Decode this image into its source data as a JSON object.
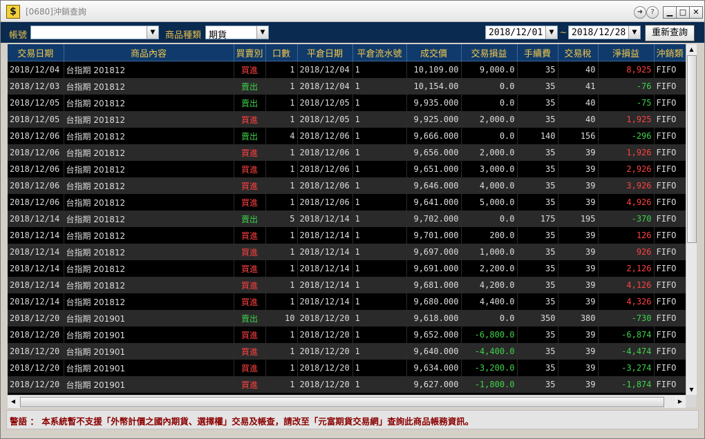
{
  "window": {
    "title": "[0680]沖銷查詢",
    "app_icon": "$"
  },
  "titlebar_buttons": {
    "help": "?",
    "minimize": "▁",
    "maximize": "□",
    "close": "✕"
  },
  "toolbar": {
    "account_label": "帳號",
    "account_value": "",
    "product_type_label": "商品種類",
    "product_type_value": "期貨",
    "date_from": "2018/12/01",
    "date_sep": "~",
    "date_to": "2018/12/28",
    "requery_label": "重新查詢"
  },
  "columns": [
    "交易日期",
    "商品內容",
    "買賣別",
    "口數",
    "平倉日期",
    "平倉流水號",
    "成交價",
    "交易損益",
    "手續費",
    "交易稅",
    "淨損益",
    "沖銷類"
  ],
  "rows": [
    {
      "date": "2018/12/04",
      "product": "台指期  201812",
      "side": "買進",
      "side_type": "buy",
      "qty": "1",
      "close_date": "2018/12/04",
      "seq": "1",
      "price": "10,109.00",
      "pl": "9,000.0",
      "pl_type": "",
      "fee": "35",
      "tax": "40",
      "net": "8,925",
      "net_type": "pos",
      "method": "FIFO"
    },
    {
      "date": "2018/12/03",
      "product": "台指期  201812",
      "side": "賣出",
      "side_type": "sell",
      "qty": "1",
      "close_date": "2018/12/04",
      "seq": "1",
      "price": "10,154.00",
      "pl": "0.0",
      "pl_type": "",
      "fee": "35",
      "tax": "41",
      "net": "-76",
      "net_type": "neg",
      "method": "FIFO"
    },
    {
      "date": "2018/12/05",
      "product": "台指期  201812",
      "side": "賣出",
      "side_type": "sell",
      "qty": "1",
      "close_date": "2018/12/05",
      "seq": "1",
      "price": "9,935.000",
      "pl": "0.0",
      "pl_type": "",
      "fee": "35",
      "tax": "40",
      "net": "-75",
      "net_type": "neg",
      "method": "FIFO"
    },
    {
      "date": "2018/12/05",
      "product": "台指期  201812",
      "side": "買進",
      "side_type": "buy",
      "qty": "1",
      "close_date": "2018/12/05",
      "seq": "1",
      "price": "9,925.000",
      "pl": "2,000.0",
      "pl_type": "",
      "fee": "35",
      "tax": "40",
      "net": "1,925",
      "net_type": "pos",
      "method": "FIFO"
    },
    {
      "date": "2018/12/06",
      "product": "台指期  201812",
      "side": "賣出",
      "side_type": "sell",
      "qty": "4",
      "close_date": "2018/12/06",
      "seq": "1",
      "price": "9,666.000",
      "pl": "0.0",
      "pl_type": "",
      "fee": "140",
      "tax": "156",
      "net": "-296",
      "net_type": "neg",
      "method": "FIFO"
    },
    {
      "date": "2018/12/06",
      "product": "台指期  201812",
      "side": "買進",
      "side_type": "buy",
      "qty": "1",
      "close_date": "2018/12/06",
      "seq": "1",
      "price": "9,656.000",
      "pl": "2,000.0",
      "pl_type": "",
      "fee": "35",
      "tax": "39",
      "net": "1,926",
      "net_type": "pos",
      "method": "FIFO"
    },
    {
      "date": "2018/12/06",
      "product": "台指期  201812",
      "side": "買進",
      "side_type": "buy",
      "qty": "1",
      "close_date": "2018/12/06",
      "seq": "1",
      "price": "9,651.000",
      "pl": "3,000.0",
      "pl_type": "",
      "fee": "35",
      "tax": "39",
      "net": "2,926",
      "net_type": "pos",
      "method": "FIFO"
    },
    {
      "date": "2018/12/06",
      "product": "台指期  201812",
      "side": "買進",
      "side_type": "buy",
      "qty": "1",
      "close_date": "2018/12/06",
      "seq": "1",
      "price": "9,646.000",
      "pl": "4,000.0",
      "pl_type": "",
      "fee": "35",
      "tax": "39",
      "net": "3,926",
      "net_type": "pos",
      "method": "FIFO"
    },
    {
      "date": "2018/12/06",
      "product": "台指期  201812",
      "side": "買進",
      "side_type": "buy",
      "qty": "1",
      "close_date": "2018/12/06",
      "seq": "1",
      "price": "9,641.000",
      "pl": "5,000.0",
      "pl_type": "",
      "fee": "35",
      "tax": "39",
      "net": "4,926",
      "net_type": "pos",
      "method": "FIFO"
    },
    {
      "date": "2018/12/14",
      "product": "台指期  201812",
      "side": "賣出",
      "side_type": "sell",
      "qty": "5",
      "close_date": "2018/12/14",
      "seq": "1",
      "price": "9,702.000",
      "pl": "0.0",
      "pl_type": "",
      "fee": "175",
      "tax": "195",
      "net": "-370",
      "net_type": "neg",
      "method": "FIFO"
    },
    {
      "date": "2018/12/14",
      "product": "台指期  201812",
      "side": "買進",
      "side_type": "buy",
      "qty": "1",
      "close_date": "2018/12/14",
      "seq": "1",
      "price": "9,701.000",
      "pl": "200.0",
      "pl_type": "",
      "fee": "35",
      "tax": "39",
      "net": "126",
      "net_type": "pos",
      "method": "FIFO"
    },
    {
      "date": "2018/12/14",
      "product": "台指期  201812",
      "side": "買進",
      "side_type": "buy",
      "qty": "1",
      "close_date": "2018/12/14",
      "seq": "1",
      "price": "9,697.000",
      "pl": "1,000.0",
      "pl_type": "",
      "fee": "35",
      "tax": "39",
      "net": "926",
      "net_type": "pos",
      "method": "FIFO"
    },
    {
      "date": "2018/12/14",
      "product": "台指期  201812",
      "side": "買進",
      "side_type": "buy",
      "qty": "1",
      "close_date": "2018/12/14",
      "seq": "1",
      "price": "9,691.000",
      "pl": "2,200.0",
      "pl_type": "",
      "fee": "35",
      "tax": "39",
      "net": "2,126",
      "net_type": "pos",
      "method": "FIFO"
    },
    {
      "date": "2018/12/14",
      "product": "台指期  201812",
      "side": "買進",
      "side_type": "buy",
      "qty": "1",
      "close_date": "2018/12/14",
      "seq": "1",
      "price": "9,681.000",
      "pl": "4,200.0",
      "pl_type": "",
      "fee": "35",
      "tax": "39",
      "net": "4,126",
      "net_type": "pos",
      "method": "FIFO"
    },
    {
      "date": "2018/12/14",
      "product": "台指期  201812",
      "side": "買進",
      "side_type": "buy",
      "qty": "1",
      "close_date": "2018/12/14",
      "seq": "1",
      "price": "9,680.000",
      "pl": "4,400.0",
      "pl_type": "",
      "fee": "35",
      "tax": "39",
      "net": "4,326",
      "net_type": "pos",
      "method": "FIFO"
    },
    {
      "date": "2018/12/20",
      "product": "台指期  201901",
      "side": "賣出",
      "side_type": "sell",
      "qty": "10",
      "close_date": "2018/12/20",
      "seq": "1",
      "price": "9,618.000",
      "pl": "0.0",
      "pl_type": "",
      "fee": "350",
      "tax": "380",
      "net": "-730",
      "net_type": "neg",
      "method": "FIFO"
    },
    {
      "date": "2018/12/20",
      "product": "台指期  201901",
      "side": "買進",
      "side_type": "buy",
      "qty": "1",
      "close_date": "2018/12/20",
      "seq": "1",
      "price": "9,652.000",
      "pl": "-6,800.0",
      "pl_type": "neg",
      "fee": "35",
      "tax": "39",
      "net": "-6,874",
      "net_type": "neg",
      "method": "FIFO"
    },
    {
      "date": "2018/12/20",
      "product": "台指期  201901",
      "side": "買進",
      "side_type": "buy",
      "qty": "1",
      "close_date": "2018/12/20",
      "seq": "1",
      "price": "9,640.000",
      "pl": "-4,400.0",
      "pl_type": "neg",
      "fee": "35",
      "tax": "39",
      "net": "-4,474",
      "net_type": "neg",
      "method": "FIFO"
    },
    {
      "date": "2018/12/20",
      "product": "台指期  201901",
      "side": "買進",
      "side_type": "buy",
      "qty": "1",
      "close_date": "2018/12/20",
      "seq": "1",
      "price": "9,634.000",
      "pl": "-3,200.0",
      "pl_type": "neg",
      "fee": "35",
      "tax": "39",
      "net": "-3,274",
      "net_type": "neg",
      "method": "FIFO"
    },
    {
      "date": "2018/12/20",
      "product": "台指期  201901",
      "side": "買進",
      "side_type": "buy",
      "qty": "1",
      "close_date": "2018/12/20",
      "seq": "1",
      "price": "9,627.000",
      "pl": "-1,800.0",
      "pl_type": "neg",
      "fee": "35",
      "tax": "39",
      "net": "-1,874",
      "net_type": "neg",
      "method": "FIFO"
    }
  ],
  "scrollbars": {
    "up": "▲",
    "down": "▼",
    "left": "◀",
    "right": "▶"
  },
  "warning": "警語 ： 本系統暫不支援「外幣計價之國內期貨、選擇權」交易及帳查，請改至「元富期貨交易網」查詢此商品帳務資訊。",
  "colors": {
    "header_bg": "#0f3a6b",
    "header_text": "#f4c84a",
    "buy": "#ff4040",
    "sell": "#3fd24a",
    "negative": "#3fd24a",
    "positive": "#ff4040",
    "warning_text": "#8a0000"
  }
}
